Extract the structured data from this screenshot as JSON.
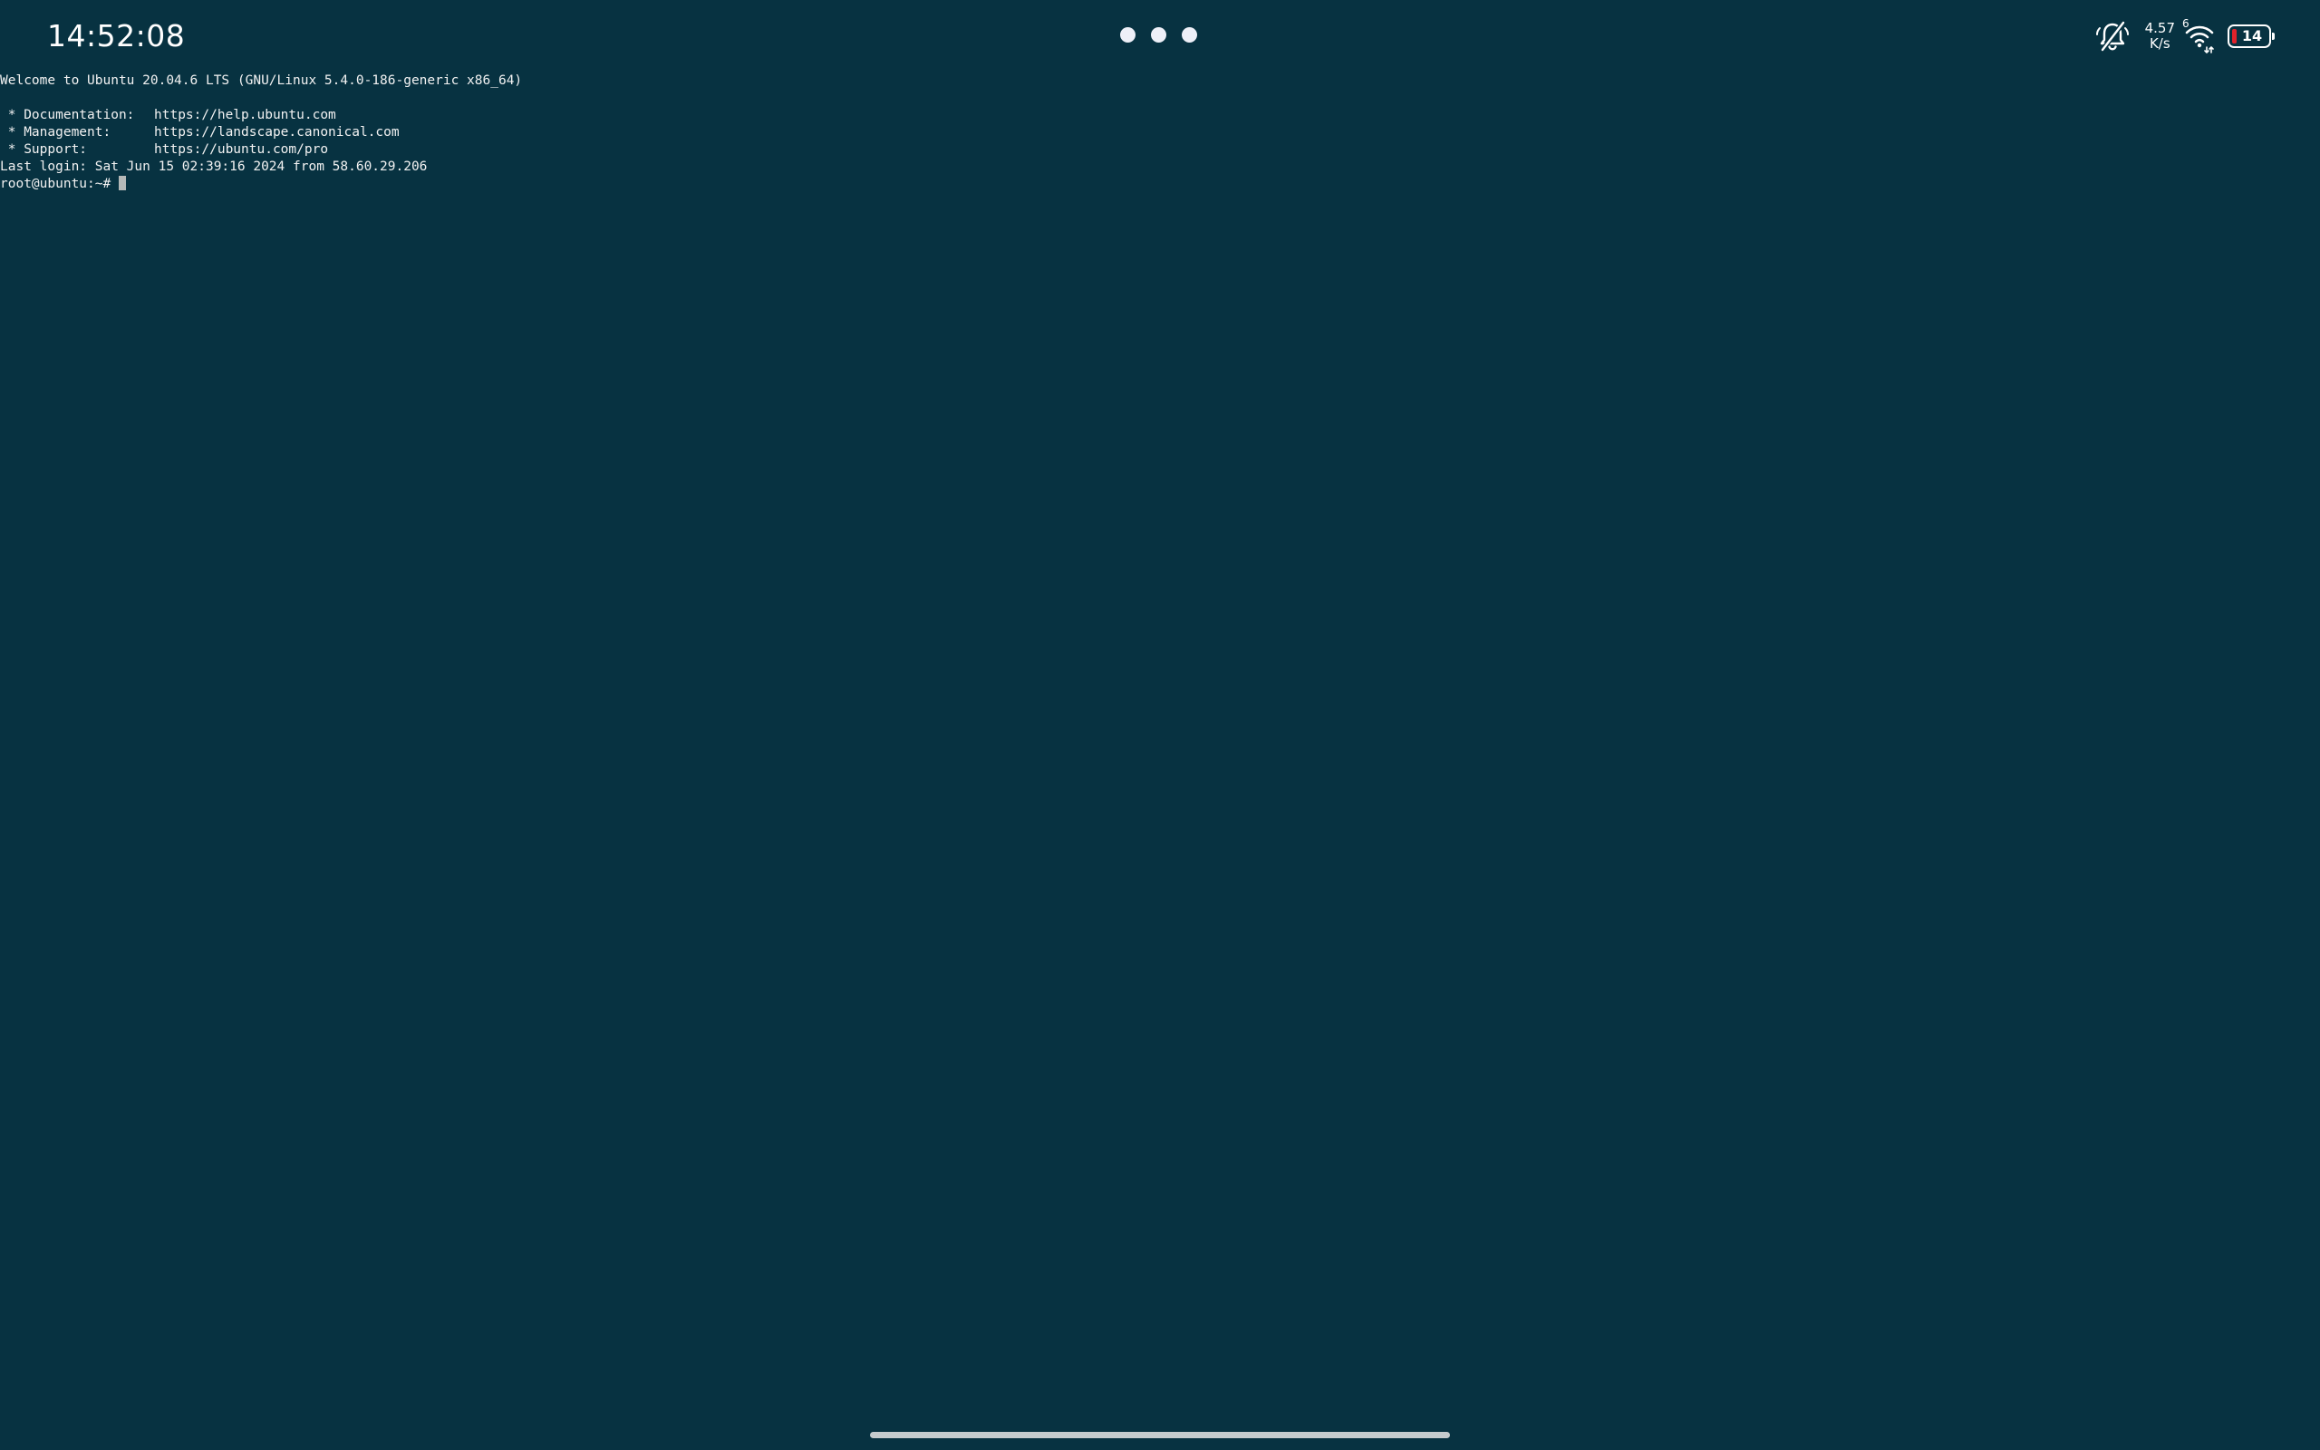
{
  "status_bar": {
    "time": "14:52:08",
    "net_speed_value": "4.57",
    "net_speed_unit": "K/s",
    "wifi_badge": "6",
    "battery_level": "14",
    "battery_color": "#e0232b",
    "icons": [
      "mute-bell-icon",
      "wifi-icon",
      "battery-icon"
    ]
  },
  "terminal": {
    "background": "#073241",
    "welcome": "Welcome to Ubuntu 20.04.6 LTS (GNU/Linux 5.4.0-186-generic x86_64)",
    "links": [
      {
        "label": " * Documentation:",
        "url": "https://help.ubuntu.com"
      },
      {
        "label": " * Management:",
        "url": "https://landscape.canonical.com"
      },
      {
        "label": " * Support:",
        "url": "https://ubuntu.com/pro"
      }
    ],
    "last_login": "Last login: Sat Jun 15 02:39:16 2024 from 58.60.29.206",
    "prompt": "root@ubuntu:~#"
  }
}
